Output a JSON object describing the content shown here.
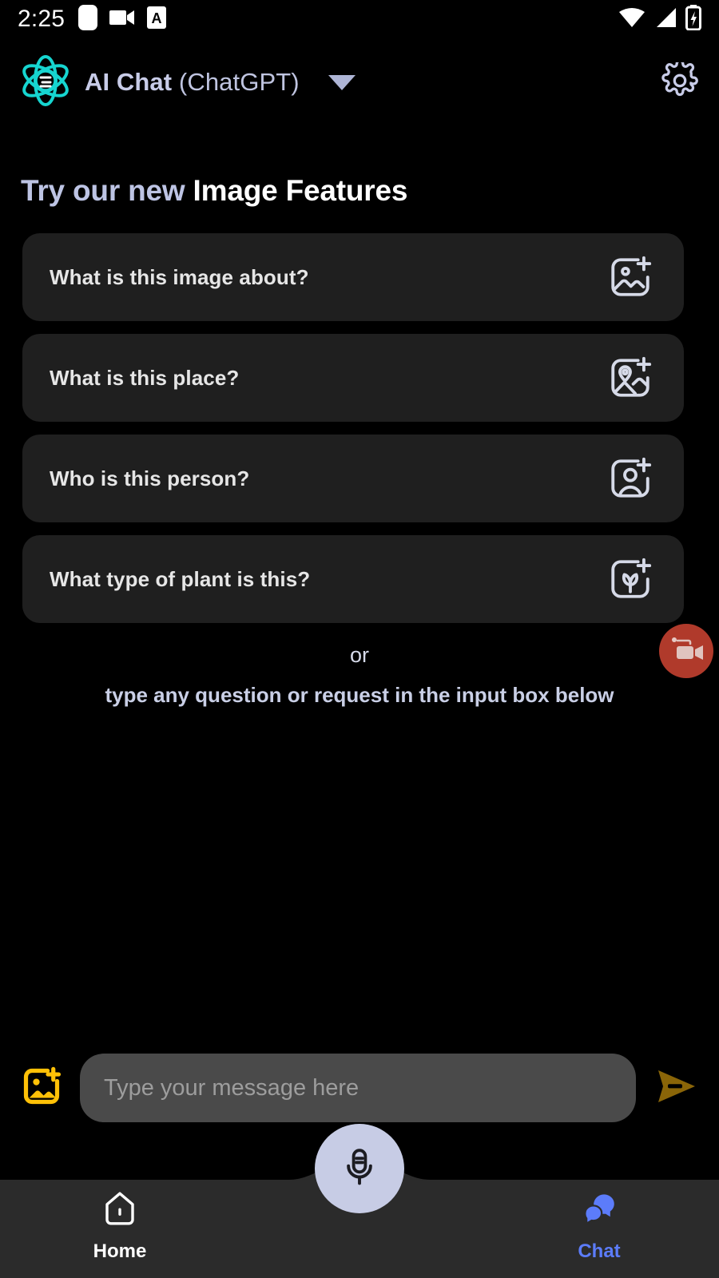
{
  "status_bar": {
    "time": "2:25",
    "left_icons": [
      "rounded-square-icon",
      "video-record-icon",
      "a-badge-icon"
    ],
    "right_icons": [
      "wifi-icon",
      "cell-signal-icon",
      "battery-charging-icon"
    ]
  },
  "header": {
    "logo_icon": "atom-logo-icon",
    "title_strong": "AI Chat",
    "title_light": "(ChatGPT)",
    "dropdown_icon": "chevron-down-icon",
    "settings_icon": "gear-icon"
  },
  "headline": {
    "part_light": "Try our new",
    "part_white": " Image Features"
  },
  "cards": [
    {
      "label": "What is this image about?",
      "icon": "image-plus-icon"
    },
    {
      "label": "What is this place?",
      "icon": "location-image-plus-icon"
    },
    {
      "label": "Who is this person?",
      "icon": "person-image-plus-icon"
    },
    {
      "label": "What type of plant is this?",
      "icon": "plant-image-plus-icon"
    }
  ],
  "divider": {
    "or_label": "or",
    "hint": "type any question or request in the input box below"
  },
  "floating_button": {
    "icon": "screen-record-camera-icon",
    "color": "#B03A2B"
  },
  "input_bar": {
    "attach_icon": "image-plus-attach-icon",
    "placeholder": "Type your message here",
    "value": "",
    "send_icon": "send-arrow-icon",
    "attach_color": "#FFC107",
    "send_color": "#8A6508"
  },
  "bottom_nav": {
    "items": [
      {
        "label": "Home",
        "icon": "home-icon",
        "active": false
      },
      {
        "label": "Chat",
        "icon": "chat-bubbles-icon",
        "active": true
      }
    ],
    "center_button": {
      "icon": "microphone-icon",
      "color": "#C7CCE5"
    },
    "active_color": "#5C7CFA"
  }
}
